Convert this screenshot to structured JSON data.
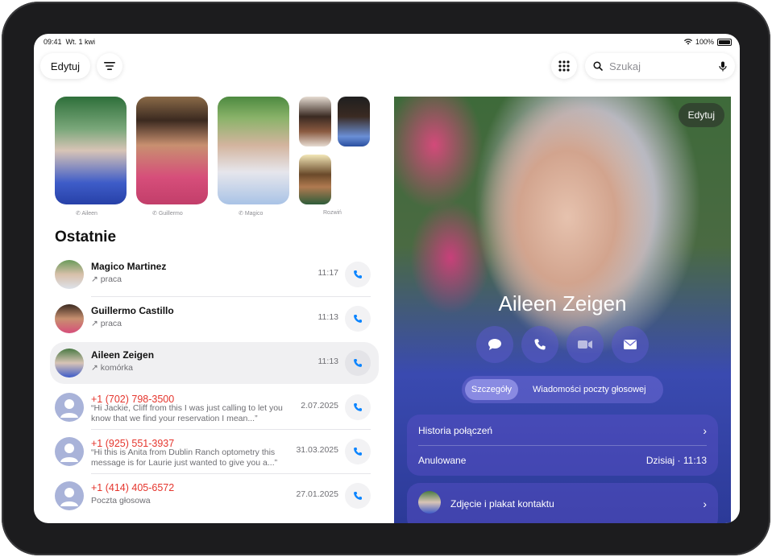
{
  "status": {
    "time": "09:41",
    "date": "Wt. 1 kwi",
    "battery": "100%"
  },
  "toolbar": {
    "edit_label": "Edytuj",
    "search_placeholder": "Szukaj"
  },
  "favorites": [
    {
      "label": "Aileen"
    },
    {
      "label": "Guillermo"
    },
    {
      "label": "Magico"
    },
    {
      "label": "Rozwiń"
    }
  ],
  "recents": {
    "title": "Ostatnie",
    "items": [
      {
        "name": "Magico Martinez",
        "sub": "praca",
        "time": "11:17"
      },
      {
        "name": "Guillermo Castillo",
        "sub": "praca",
        "time": "11:13"
      },
      {
        "name": "Aileen Zeigen",
        "sub": "komórka",
        "time": "11:13"
      },
      {
        "name": "+1 (702) 798-3500",
        "msg": "“Hi Jackie, Cliff from this I was just calling to let you know that we find your reservation  I mean...”",
        "time": "2.07.2025"
      },
      {
        "name": "+1 (925) 551-3937",
        "msg": "“Hi this is Anita from Dublin Ranch optometry this message is for Laurie just wanted to give you a...”",
        "time": "31.03.2025"
      },
      {
        "name": "+1 (414) 405-6572",
        "sub": "Poczta głosowa",
        "time": "27.01.2025"
      }
    ]
  },
  "detail": {
    "edit_label": "Edytuj",
    "name": "Aileen Zeigen",
    "segments": [
      "Szczegóły",
      "Wiadomości poczty głosowej"
    ],
    "history_label": "Historia połączeń",
    "cancelled_label": "Anulowane",
    "cancelled_time": "Dzisiaj · 11:13",
    "photo_label": "Zdjęcie i plakat kontaktu"
  },
  "colors": {
    "accent": "#0a84ff",
    "missed": "#e5352d"
  }
}
